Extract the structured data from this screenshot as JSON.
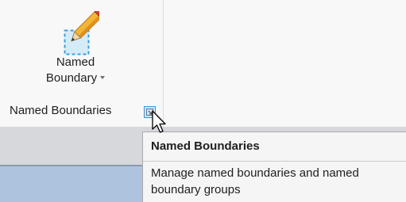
{
  "ribbon": {
    "named_boundary_button": {
      "label_line1": "Named",
      "label_line2": "Boundary",
      "icon": "pencil-boundary-icon",
      "has_dropdown": true
    },
    "panel_title": "Named Boundaries",
    "dialog_launcher_icon": "dialog-launcher-icon"
  },
  "tooltip": {
    "title": "Named Boundaries",
    "description": "Manage named boundaries and named boundary groups"
  },
  "colors": {
    "ribbon_bg": "#f8f8f8",
    "band_gray": "#d6d8db",
    "blue_area": "#aec3de",
    "tooltip_bg": "#f5f5f5",
    "accent_blue": "#3c93d6",
    "pencil_yellow": "#f2b635",
    "pencil_orange": "#e07b1a"
  }
}
